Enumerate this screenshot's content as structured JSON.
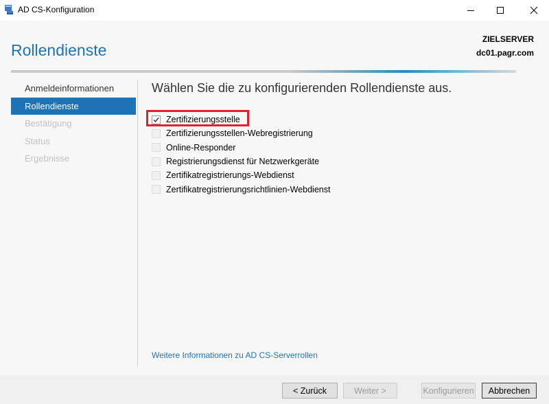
{
  "window": {
    "title": "AD CS-Konfiguration",
    "controls": [
      "minimize",
      "maximize",
      "close"
    ]
  },
  "header": {
    "page_title": "Rollendienste",
    "server_label": "ZIELSERVER",
    "server_name": "dc01.pagr.com"
  },
  "nav": {
    "items": [
      {
        "label": "Anmeldeinformationen",
        "state": "normal"
      },
      {
        "label": "Rollendienste",
        "state": "active"
      },
      {
        "label": "Bestätigung",
        "state": "disabled"
      },
      {
        "label": "Status",
        "state": "disabled"
      },
      {
        "label": "Ergebnisse",
        "state": "disabled"
      }
    ]
  },
  "main": {
    "instruction": "Wählen Sie die zu konfigurierenden Rollendienste aus.",
    "options": [
      {
        "label": "Zertifizierungsstelle",
        "checked": true,
        "highlighted": true
      },
      {
        "label": "Zertifizierungsstellen-Webregistrierung",
        "checked": false
      },
      {
        "label": "Online-Responder",
        "checked": false
      },
      {
        "label": "Registrierungsdienst für Netzwerkgeräte",
        "checked": false
      },
      {
        "label": "Zertifikatregistrierungs-Webdienst",
        "checked": false
      },
      {
        "label": "Zertifikatregistrierungsrichtlinien-Webdienst",
        "checked": false
      }
    ],
    "info_link": "Weitere Informationen zu AD CS-Serverrollen"
  },
  "footer": {
    "back_label": "< Zurück",
    "next_label": "Weiter >",
    "configure_label": "Konfigurieren",
    "cancel_label": "Abbrechen"
  },
  "colors": {
    "accent": "#1e73b4",
    "highlight_border": "#e0202c",
    "disabled_text": "#c2c2c2"
  }
}
